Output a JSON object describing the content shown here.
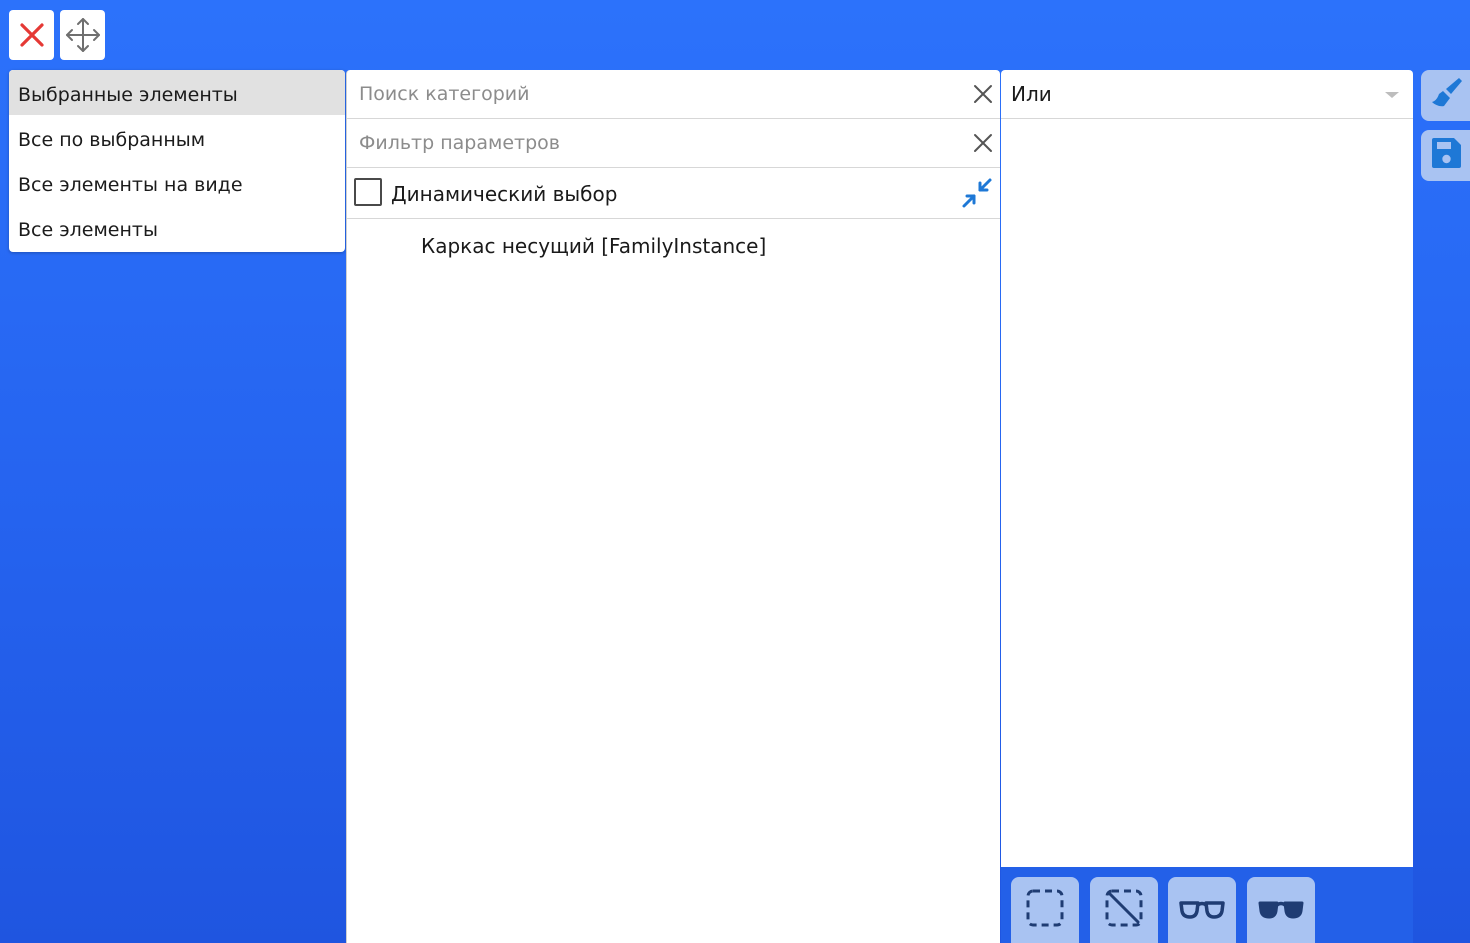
{
  "toolbar": {
    "close_icon": "close-icon",
    "move_icon": "move-icon",
    "close_color": "#e53935"
  },
  "selection_modes": {
    "items": [
      {
        "label": "Выбранные элементы",
        "selected": true
      },
      {
        "label": "Все по выбранным",
        "selected": false
      },
      {
        "label": "Все элементы на виде",
        "selected": false
      },
      {
        "label": "Все элементы",
        "selected": false
      }
    ]
  },
  "filters": {
    "category_search": {
      "placeholder": "Поиск категорий",
      "value": ""
    },
    "parameter_filter": {
      "placeholder": "Фильтр параметров",
      "value": ""
    },
    "dynamic_selection": {
      "label": "Динамический выбор",
      "checked": false
    },
    "tree": [
      {
        "label": "Каркас несущий [FamilyInstance]"
      }
    ]
  },
  "logic_panel": {
    "operator": "Или"
  },
  "side_actions": [
    {
      "icon": "brush-icon"
    },
    {
      "icon": "save-icon"
    }
  ],
  "bottom_actions": [
    {
      "icon": "select-region-icon"
    },
    {
      "icon": "deselect-region-icon"
    },
    {
      "icon": "glasses-outline-icon"
    },
    {
      "icon": "sunglasses-icon"
    }
  ],
  "colors": {
    "background": "#2c72fb",
    "accent": "#1e78d6",
    "button_light": "#a9c3f2",
    "icon_dark": "#1f3c73"
  }
}
